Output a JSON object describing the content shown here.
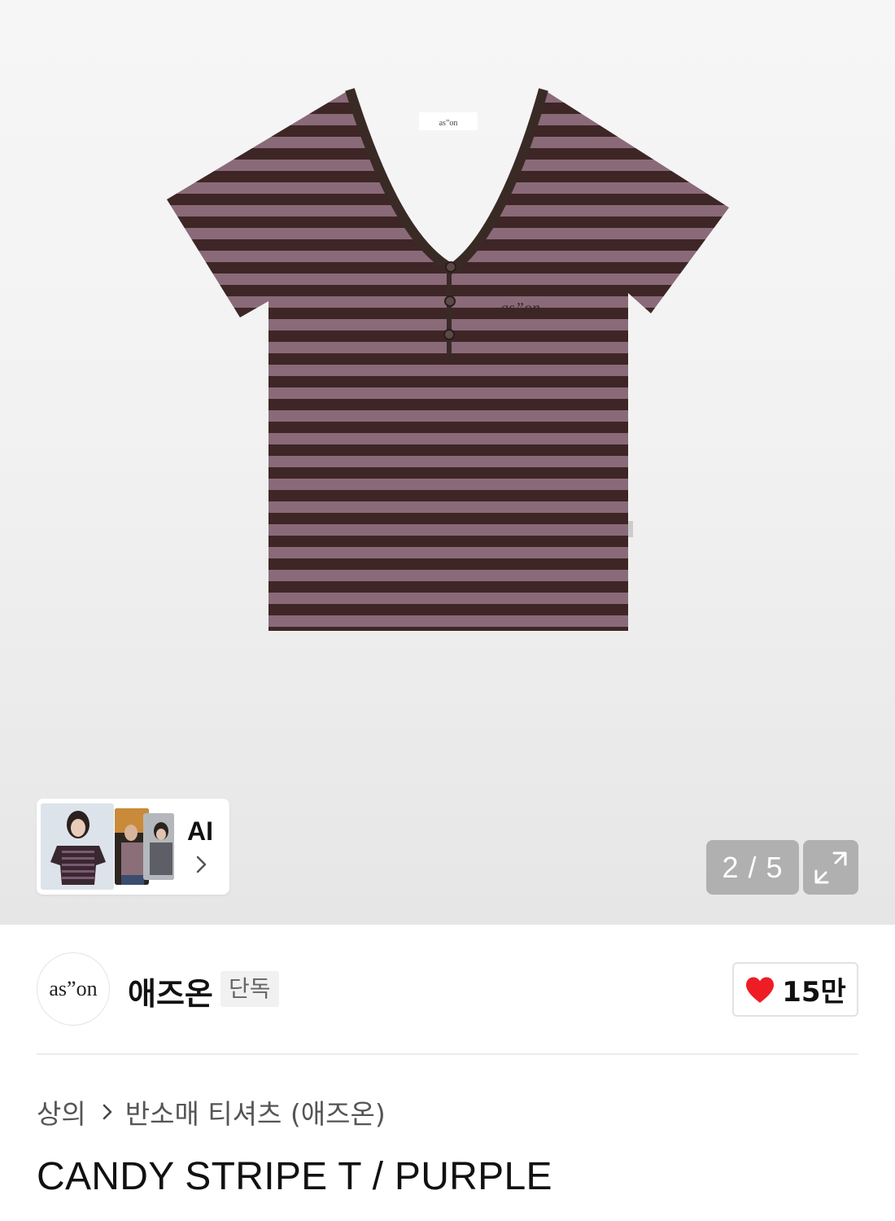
{
  "gallery": {
    "product_alt": "CANDY STRIPE T / PURPLE",
    "tag_brand": "as”on",
    "ai_label": "AI",
    "counter": {
      "current": 2,
      "total": 5,
      "text": "2 / 5"
    }
  },
  "brand": {
    "logo_text": "as”on",
    "name": "애즈온",
    "badge": "단독"
  },
  "like": {
    "count": "15만",
    "icon": "heart-icon",
    "color": "#ee1c25"
  },
  "breadcrumb": {
    "items": [
      "상의",
      "반소매 티셔츠 (애즈온)"
    ]
  },
  "product": {
    "title": "CANDY STRIPE T / PURPLE"
  }
}
